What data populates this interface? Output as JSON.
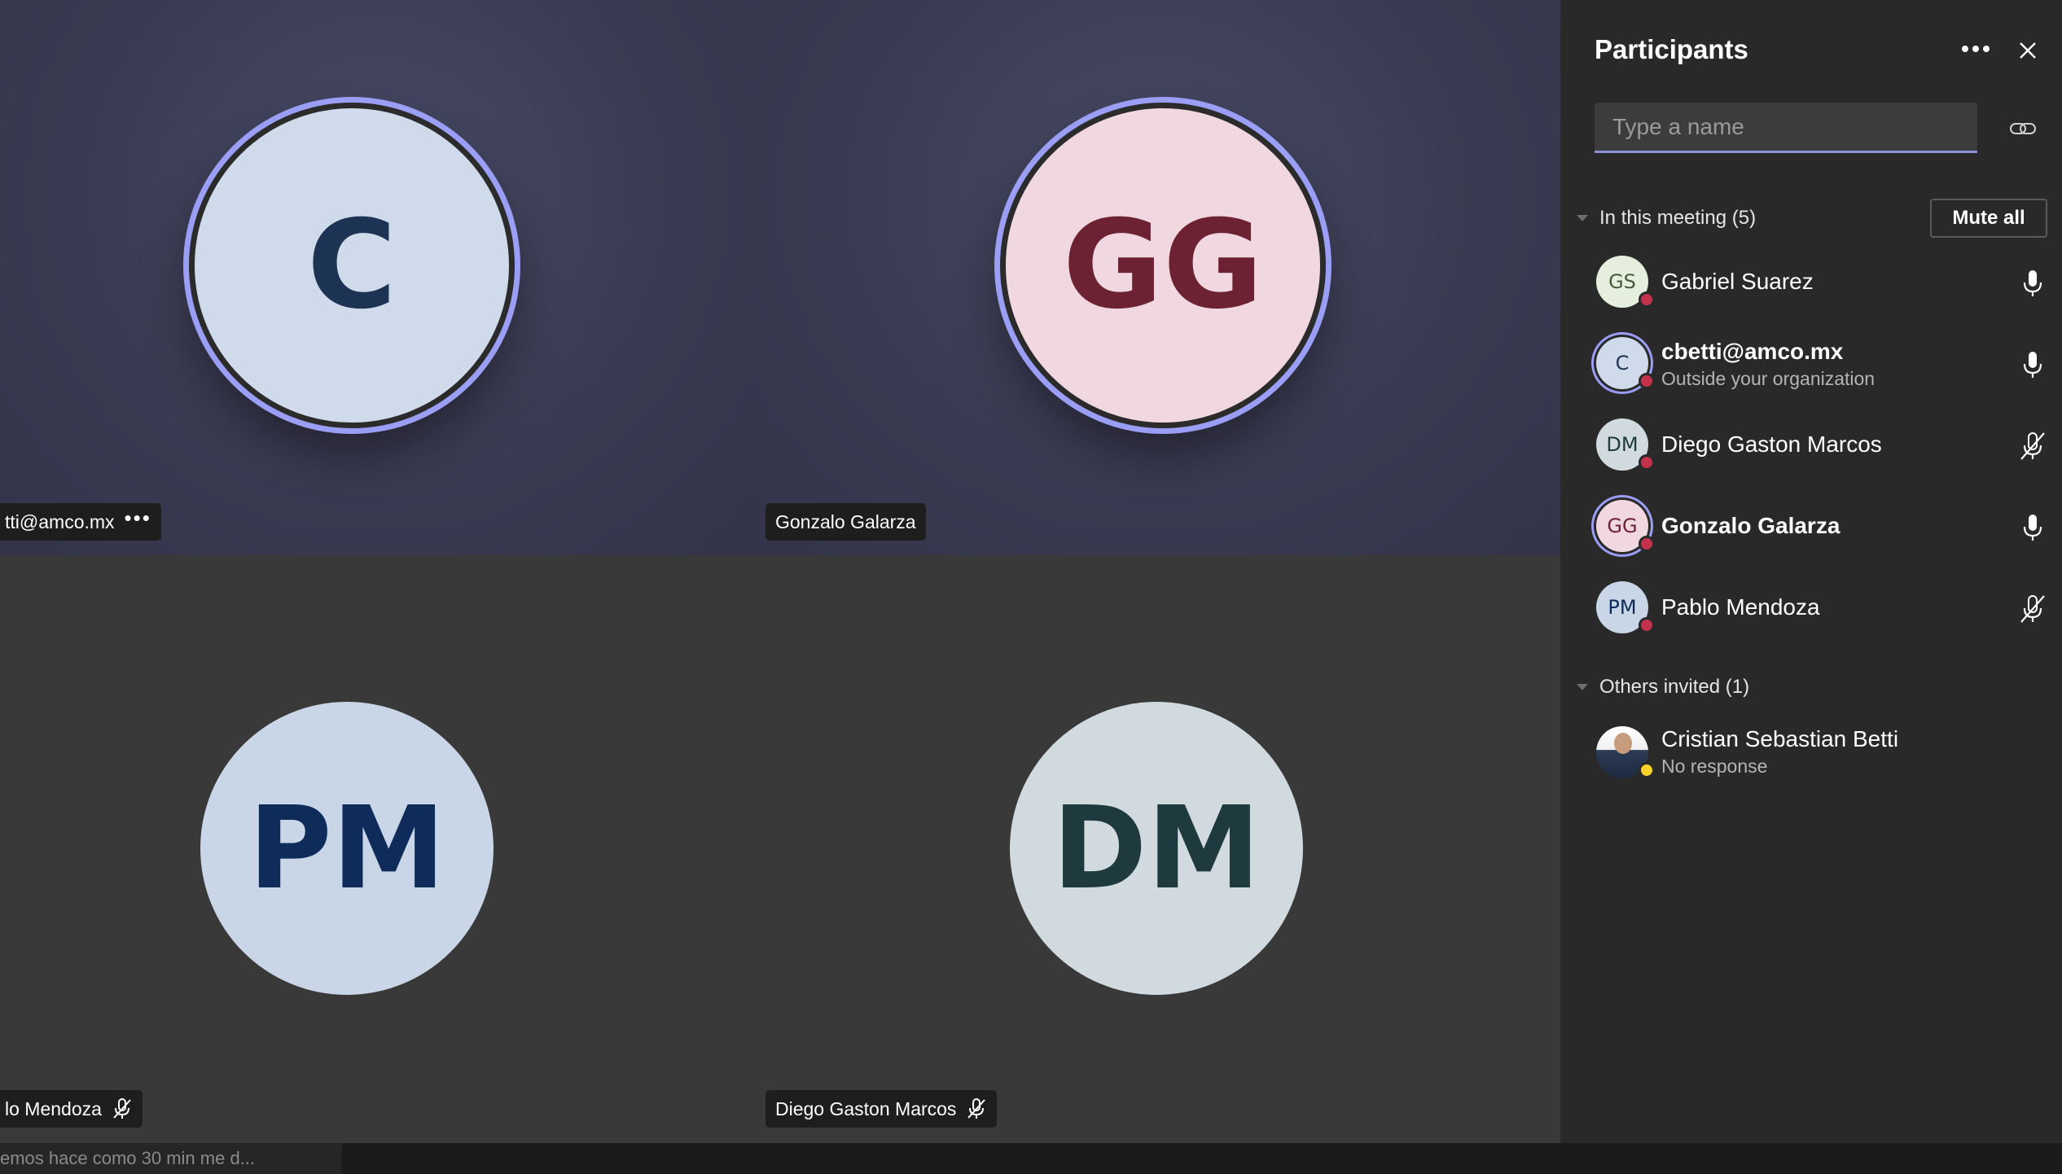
{
  "stage": {
    "tiles": [
      {
        "initials": "C",
        "name": "tti@amco.mx",
        "more": "•••"
      },
      {
        "initials": "GG",
        "name": "Gonzalo Galarza"
      },
      {
        "initials": "PM",
        "name": "lo Mendoza"
      },
      {
        "initials": "DM",
        "name": "Diego Gaston Marcos"
      }
    ]
  },
  "chat_preview": "emos hace como 30 min me d...",
  "panel": {
    "title": "Participants",
    "more": "•••",
    "search_placeholder": "Type a name",
    "in_meeting_label": "In this meeting (5)",
    "mute_all": "Mute all",
    "participants": [
      {
        "initials": "GS",
        "name": "Gabriel Suarez",
        "sub": "",
        "mic": "on",
        "avatar_bg": "#e6eedd",
        "avatar_fg": "#4a5b3c"
      },
      {
        "initials": "C",
        "name": "cbetti@amco.mx",
        "sub": "Outside your organization",
        "mic": "on",
        "avatar_bg": "#cfdbea",
        "avatar_fg": "#1d3354"
      },
      {
        "initials": "DM",
        "name": "Diego Gaston Marcos",
        "sub": "",
        "mic": "muted",
        "avatar_bg": "#d0dadf",
        "avatar_fg": "#1f3a3e"
      },
      {
        "initials": "GG",
        "name": "Gonzalo Galarza",
        "sub": "",
        "mic": "on",
        "avatar_bg": "#f1d7df",
        "avatar_fg": "#6d2233"
      },
      {
        "initials": "PM",
        "name": "Pablo Mendoza",
        "sub": "",
        "mic": "muted",
        "avatar_bg": "#c9d6e7",
        "avatar_fg": "#0f2b5a"
      }
    ],
    "others_label": "Others invited (1)",
    "invited": [
      {
        "name": "Cristian Sebastian Betti",
        "sub": "No response"
      }
    ]
  },
  "colors": {
    "speaking_ring": "#9a9ef5",
    "busy_status": "#c4314b",
    "away_status": "#f8d22a",
    "panel_bg": "#292929"
  },
  "icons": [
    "more-icon",
    "close-icon",
    "link-icon",
    "mic-icon",
    "mic-off-icon",
    "caret-down-icon"
  ]
}
